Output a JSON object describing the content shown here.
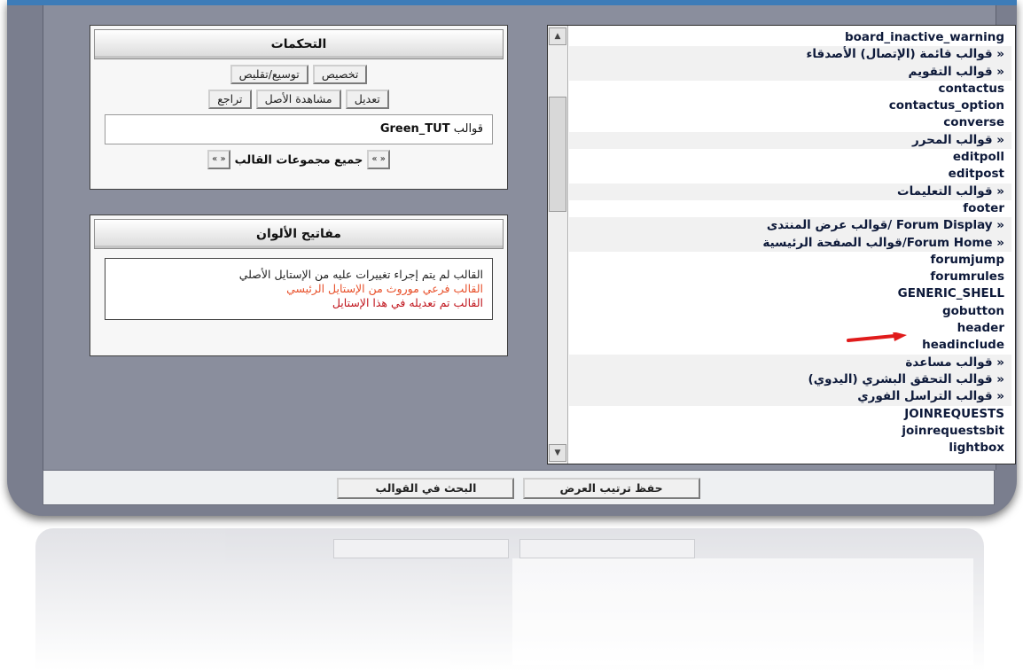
{
  "template_list": [
    "board_inactive_warning",
    "قوالب قائمة (الإتصال) الأصدقاء »",
    "قوالب التقويم »",
    "contactus",
    "contactus_option",
    "converse",
    "قوالب المحرر »",
    "editpoll",
    "editpost",
    "قوالب التعليمات »",
    "footer",
    "قوالب عرض المنتدى/ Forum Display »",
    "قوالب الصفحة الرئيسية/Forum Home »",
    "forumjump",
    "forumrules",
    "GENERIC_SHELL",
    "gobutton",
    "header",
    "headinclude",
    "قوالب مساعدة »",
    "قوالب التحقق البشري (اليدوي) »",
    "قوالب التراسل الفوري »",
    "JOINREQUESTS",
    "joinrequestsbit",
    "lightbox"
  ],
  "controls": {
    "title": "التحكمات",
    "customize": "تخصيص",
    "expand_collapse": "توسيع/تقليص",
    "edit": "تعديل",
    "view_original": "مشاهدة الأصل",
    "revert": "تراجع",
    "template_prefix": "قوالب",
    "style_name": "Green_TUT",
    "all_groups": "جميع مجموعات القالب",
    "arrows": "« »"
  },
  "color_key": {
    "title": "مفاتيح الألوان",
    "unchanged": "القالب لم يتم إجراء تغييرات عليه من الإستايل الأصلي",
    "inherited": "القالب فرعي موروث من الإستايل الرئيسي",
    "customized": "القالب تم تعديله في هذا الإستايل",
    "colors": {
      "unchanged": "#222222",
      "inherited": "#e8502a",
      "customized": "#c0141c"
    }
  },
  "bottom": {
    "save_order": "حفظ ترتيب العرض",
    "search_templates": "البحث في القوالب"
  },
  "scrollbar": {
    "up": "▲",
    "down": "▼"
  }
}
